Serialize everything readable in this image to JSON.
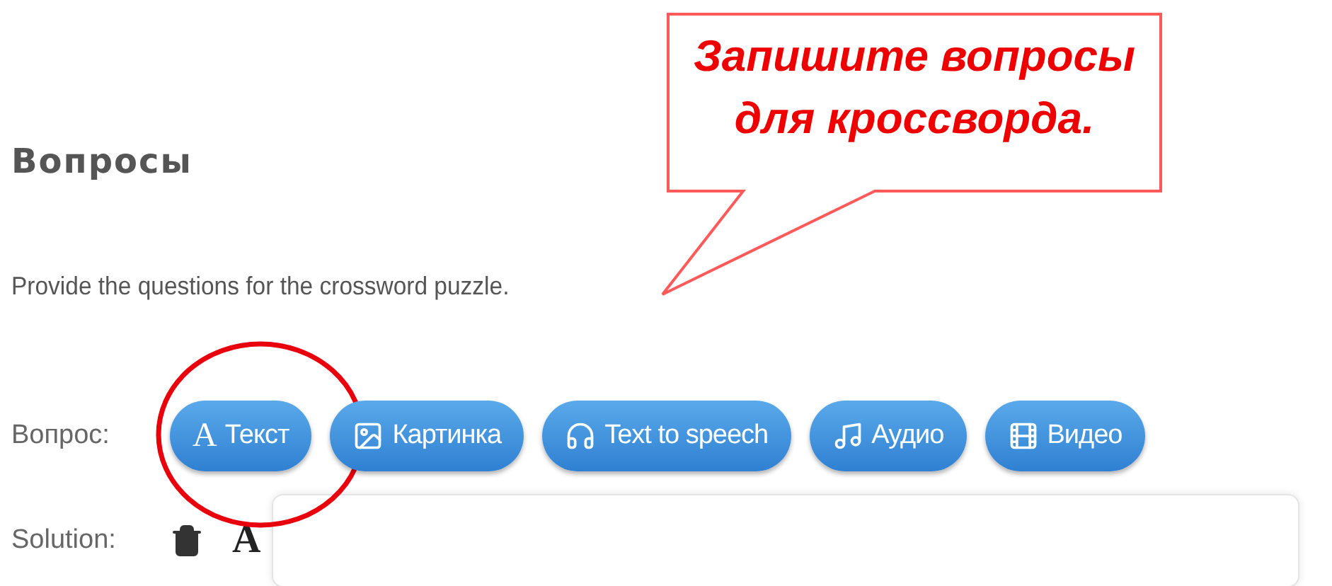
{
  "heading": "Вопросы",
  "description": "Provide the questions for the crossword puzzle.",
  "callout": {
    "text": "Запишите вопросы для кроссворда."
  },
  "question_row": {
    "label": "Вопрос:",
    "buttons": [
      {
        "kind": "text",
        "glyph": "A",
        "label": "Текст",
        "highlighted": true
      },
      {
        "kind": "image",
        "label": "Картинка",
        "highlighted": false
      },
      {
        "kind": "speech",
        "label": "Text to speech",
        "highlighted": false
      },
      {
        "kind": "audio",
        "label": "Аудио",
        "highlighted": false
      },
      {
        "kind": "video",
        "label": "Видео",
        "highlighted": false
      }
    ]
  },
  "solution_row": {
    "label": "Solution:",
    "font_glyph": "A"
  }
}
